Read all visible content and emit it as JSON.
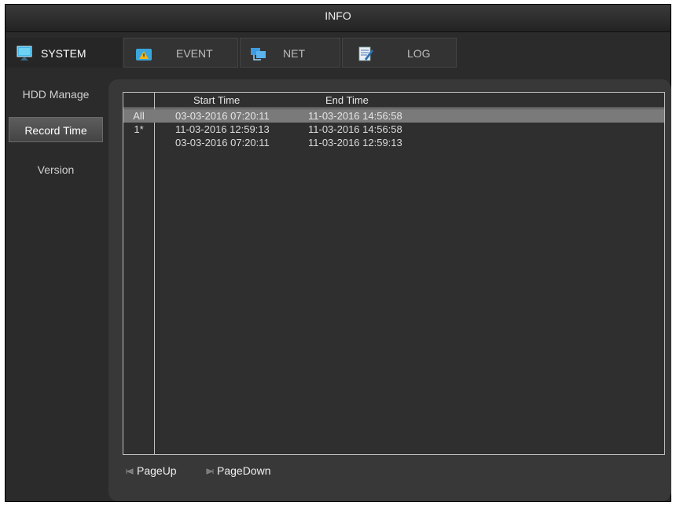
{
  "window": {
    "title": "INFO"
  },
  "tabs": [
    {
      "label": "SYSTEM",
      "icon": "monitor-icon",
      "active": true
    },
    {
      "label": "EVENT",
      "icon": "warning-icon",
      "active": false
    },
    {
      "label": "NET",
      "icon": "network-icon",
      "active": false
    },
    {
      "label": "LOG",
      "icon": "notepad-icon",
      "active": false
    }
  ],
  "sidebar": {
    "items": [
      {
        "label": "HDD Manage",
        "active": false
      },
      {
        "label": "Record Time",
        "active": true
      },
      {
        "label": "Version",
        "active": false
      }
    ]
  },
  "table": {
    "columns": [
      "",
      "Start Time",
      "End Time"
    ],
    "rows": [
      {
        "id": "All",
        "start": "03-03-2016 07:20:11",
        "end": "11-03-2016 14:56:58",
        "selected": true
      },
      {
        "id": "1*",
        "start": "11-03-2016 12:59:13",
        "end": "11-03-2016 14:56:58",
        "selected": false
      },
      {
        "id": "",
        "start": "03-03-2016 07:20:11",
        "end": "11-03-2016 12:59:13",
        "selected": false
      }
    ]
  },
  "pager": {
    "page_up": "PageUp",
    "page_down": "PageDown"
  },
  "colors": {
    "background": "#2b2b2b",
    "panel": "#383838",
    "selected_row": "#7a7a7a",
    "border": "#bfbfbf"
  }
}
